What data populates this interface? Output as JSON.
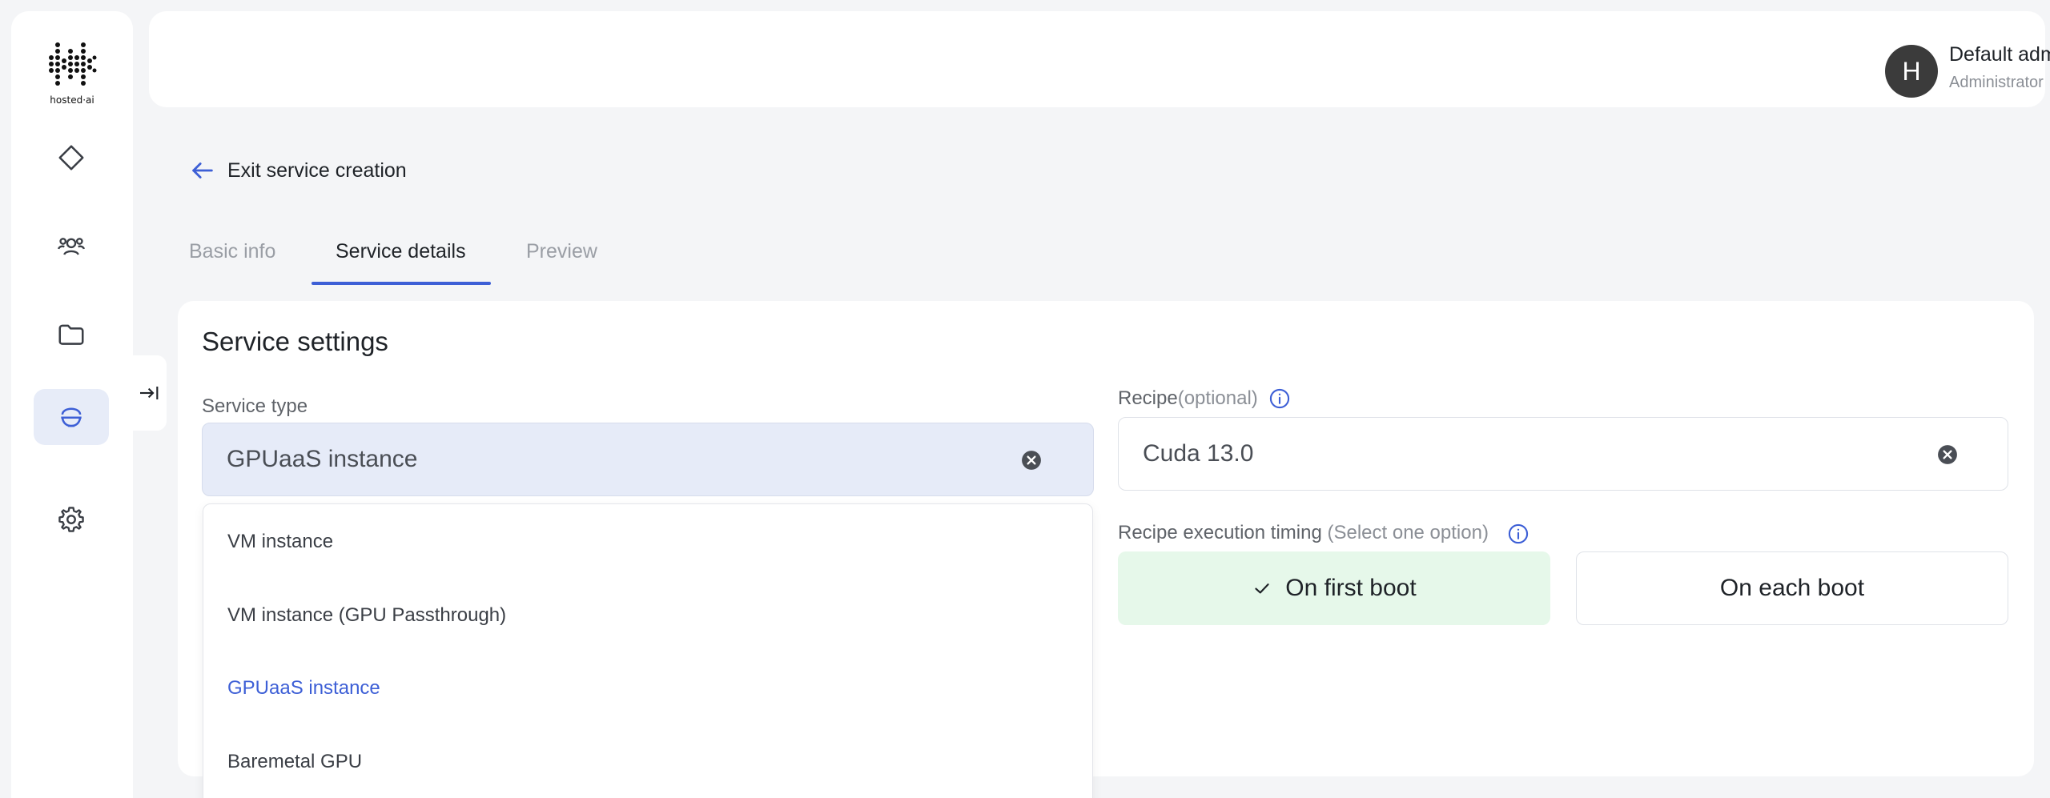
{
  "brand": {
    "logo_text": "hosted·ai"
  },
  "sidebar": {
    "items": [
      {
        "name": "dashboard",
        "icon": "diamond-icon"
      },
      {
        "name": "users",
        "icon": "users-icon"
      },
      {
        "name": "files",
        "icon": "folder-icon"
      },
      {
        "name": "services",
        "icon": "bowl-icon",
        "active": true
      },
      {
        "name": "settings",
        "icon": "gear-icon"
      }
    ],
    "collapse_icon": "collapse-right-icon"
  },
  "header": {
    "avatar_initial": "H",
    "user_name": "Default admin user",
    "user_role": "Administrator"
  },
  "back_link": {
    "label": "Exit service creation"
  },
  "tabs": [
    {
      "label": "Basic info",
      "active": false
    },
    {
      "label": "Service details",
      "active": true
    },
    {
      "label": "Preview",
      "active": false
    }
  ],
  "card": {
    "title": "Service settings",
    "service_type": {
      "label": "Service type",
      "value": "GPUaaS instance",
      "options": [
        {
          "label": "VM instance",
          "selected": false
        },
        {
          "label": "VM instance (GPU Passthrough)",
          "selected": false
        },
        {
          "label": "GPUaaS instance",
          "selected": true
        },
        {
          "label": "Baremetal GPU",
          "selected": false
        }
      ]
    },
    "recipe": {
      "label": "Recipe",
      "hint": "(optional)",
      "value": "Cuda 13.0"
    },
    "timing": {
      "label": "Recipe execution timing",
      "hint": "(Select one option)",
      "options": [
        {
          "label": "On first boot",
          "selected": true
        },
        {
          "label": "On each boot",
          "selected": false
        }
      ]
    }
  },
  "colors": {
    "accent": "#3d5fd6",
    "selected_field_bg": "#e6ebf8",
    "selected_option_bg": "#e6f8ea",
    "page_bg": "#f4f5f7"
  }
}
